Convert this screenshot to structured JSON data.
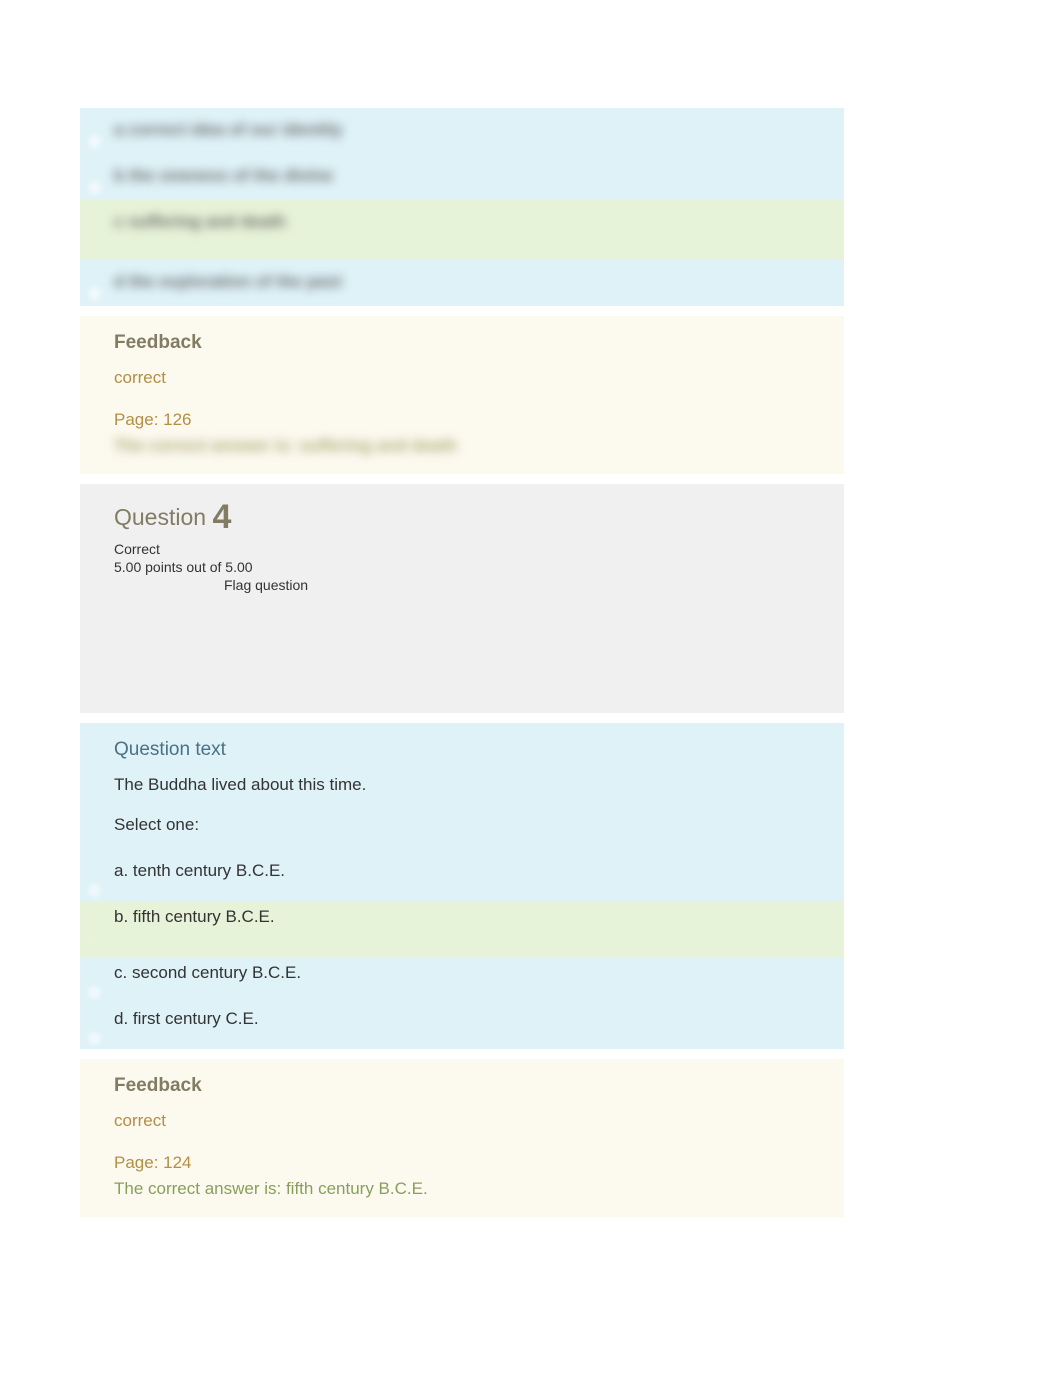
{
  "q3": {
    "options": [
      {
        "label": "a correct idea of our identity"
      },
      {
        "label": "b the oneness of the divine"
      },
      {
        "label": "c suffering and death"
      },
      {
        "label": "d the exploration of the past"
      }
    ],
    "feedback": {
      "heading": "Feedback",
      "correct": "correct",
      "page": "Page: 126",
      "answer": "The correct answer is: suffering and death"
    }
  },
  "q4": {
    "title_prefix": "Question ",
    "number": "4",
    "status": "Correct",
    "points": "5.00 points out of 5.00",
    "flag": "Flag question",
    "question_text_heading": "Question text",
    "question_text": "The Buddha lived about this time.",
    "select_one": "Select one:",
    "options": [
      {
        "label": "a. tenth century B.C.E."
      },
      {
        "label": "b. fifth century B.C.E."
      },
      {
        "label": "c. second century B.C.E."
      },
      {
        "label": "d. first century C.E."
      }
    ],
    "feedback": {
      "heading": "Feedback",
      "correct": "correct",
      "page": "Page: 124",
      "answer": "The correct answer is: fifth century B.C.E."
    }
  }
}
